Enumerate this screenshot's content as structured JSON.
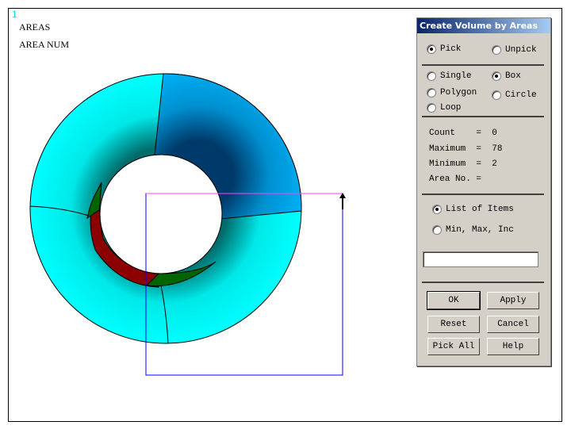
{
  "graphics": {
    "window_number": "1",
    "label1": "AREAS",
    "label2": "AREA NUM"
  },
  "panel": {
    "title": "Create Volume by Areas",
    "pick": "Pick",
    "unpick": "Unpick",
    "single": "Single",
    "box": "Box",
    "polygon": "Polygon",
    "circle": "Circle",
    "loop": "Loop",
    "count": "Count    =  0",
    "maximum": "Maximum  =  78",
    "minimum": "Minimum  =  2",
    "area_no": "Area No. =",
    "list_of_items": "List of Items",
    "min_max_inc": "Min, Max, Inc",
    "input_value": "",
    "ok": "OK",
    "apply": "Apply",
    "reset": "Reset",
    "cancel": "Cancel",
    "pick_all": "Pick All",
    "help": "Help"
  },
  "colors": {
    "cyan": "#00ffff",
    "blue": "#00b4ff",
    "red": "#8b0000",
    "green": "#006400",
    "box": "#0000ff"
  }
}
